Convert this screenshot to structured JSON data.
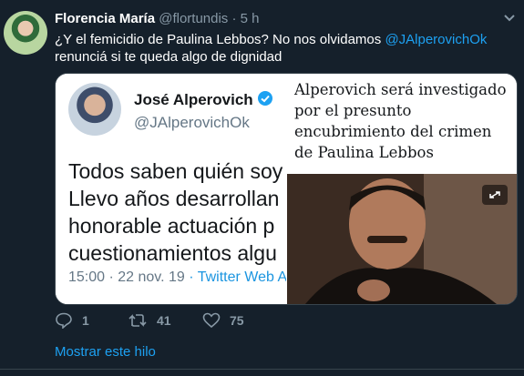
{
  "tweet": {
    "name": "Florencia María",
    "handle": "@flortundis",
    "separator": "·",
    "time": "5 h",
    "text_1": "¿Y el femicidio de Paulina Lebbos? No nos olvidamos ",
    "mention": "@JAlperovichOk",
    "text_2": "renunciá si te queda algo de dignidad"
  },
  "quoted": {
    "name": "José Alperovich",
    "handle": "@JAlperovichOk",
    "lines": [
      "Todos saben quién soy",
      "Llevo años desarrollan",
      "honorable actuación p",
      "cuestionamientos algu"
    ],
    "timestamp": "15:00 · 22 nov. 19",
    "source": " · Twitter Web A"
  },
  "article": {
    "headline": "Alperovich será investigado por el presunto encubrimiento del crimen de Paulina Lebbos"
  },
  "actions": {
    "reply_count": "1",
    "retweet_count": "41",
    "like_count": "75"
  },
  "show_thread": "Mostrar este hilo",
  "colors": {
    "background": "#15202b",
    "accent": "#1da1f2",
    "muted": "#8899a6"
  },
  "icons": [
    "chevron-down-icon",
    "verified-icon",
    "expand-icon",
    "reply-icon",
    "retweet-icon",
    "like-icon"
  ]
}
